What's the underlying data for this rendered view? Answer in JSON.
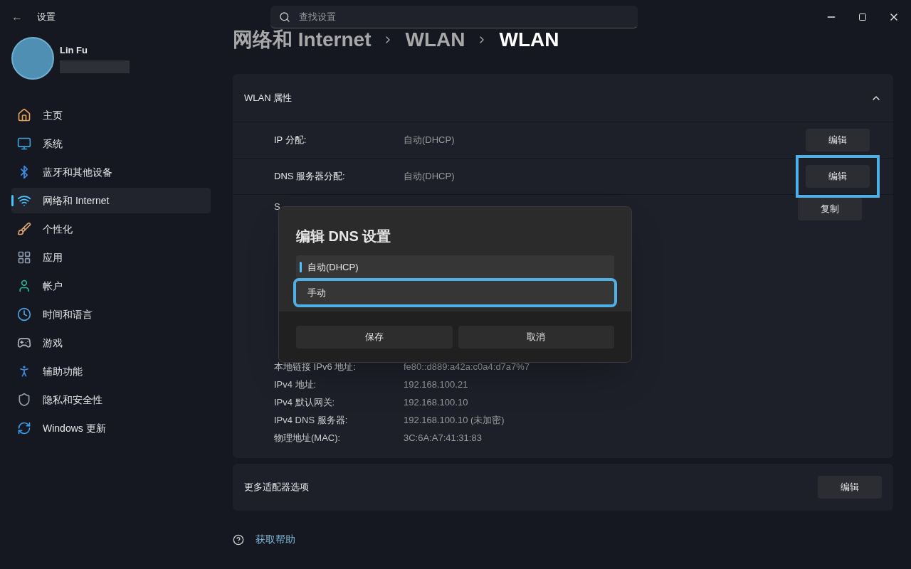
{
  "window": {
    "title": "设置",
    "back": "←"
  },
  "search": {
    "placeholder": "查找设置"
  },
  "user": {
    "name": "Lin Fu"
  },
  "sidebar": {
    "items": [
      {
        "label": "主页",
        "kind": "home",
        "selected": false
      },
      {
        "label": "系统",
        "kind": "system",
        "selected": false
      },
      {
        "label": "蓝牙和其他设备",
        "kind": "bluetooth",
        "selected": false
      },
      {
        "label": "网络和 Internet",
        "kind": "network",
        "selected": true
      },
      {
        "label": "个性化",
        "kind": "brush",
        "selected": false
      },
      {
        "label": "应用",
        "kind": "apps",
        "selected": false
      },
      {
        "label": "帐户",
        "kind": "account",
        "selected": false
      },
      {
        "label": "时间和语言",
        "kind": "time",
        "selected": false
      },
      {
        "label": "游戏",
        "kind": "game",
        "selected": false
      },
      {
        "label": "辅助功能",
        "kind": "access",
        "selected": false
      },
      {
        "label": "隐私和安全性",
        "kind": "shield",
        "selected": false
      },
      {
        "label": "Windows 更新",
        "kind": "update",
        "selected": false
      }
    ]
  },
  "breadcrumb": [
    "网络和 Internet",
    "WLAN",
    "WLAN"
  ],
  "properties": {
    "title": "WLAN 属性",
    "expanded": true,
    "edit_rows": [
      {
        "label": "IP 分配:",
        "value": "自动(DHCP)",
        "button": "编辑",
        "highlighted": false
      },
      {
        "label": "DNS 服务器分配:",
        "value": "自动(DHCP)",
        "button": "编辑",
        "highlighted": true
      }
    ],
    "copy_button": "复制",
    "partial_label": "S",
    "details": [
      {
        "label": "本地链接 IPv6 地址:",
        "value": "fe80::d889:a42a:c0a4:d7a7%7"
      },
      {
        "label": "IPv4 地址:",
        "value": "192.168.100.21"
      },
      {
        "label": "IPv4 默认网关:",
        "value": "192.168.100.10"
      },
      {
        "label": "IPv4 DNS 服务器:",
        "value": "192.168.100.10 (未加密)"
      },
      {
        "label": "物理地址(MAC):",
        "value": "3C:6A:A7:41:31:83"
      }
    ]
  },
  "more_options": {
    "label": "更多适配器选项",
    "button": "编辑"
  },
  "help": {
    "label": "获取帮助"
  },
  "dialog": {
    "title": "编辑 DNS 设置",
    "options": [
      {
        "label": "自动(DHCP)",
        "selected": true,
        "highlighted": false
      },
      {
        "label": "手动",
        "selected": false,
        "highlighted": true
      }
    ],
    "buttons": [
      "保存",
      "取消"
    ]
  }
}
